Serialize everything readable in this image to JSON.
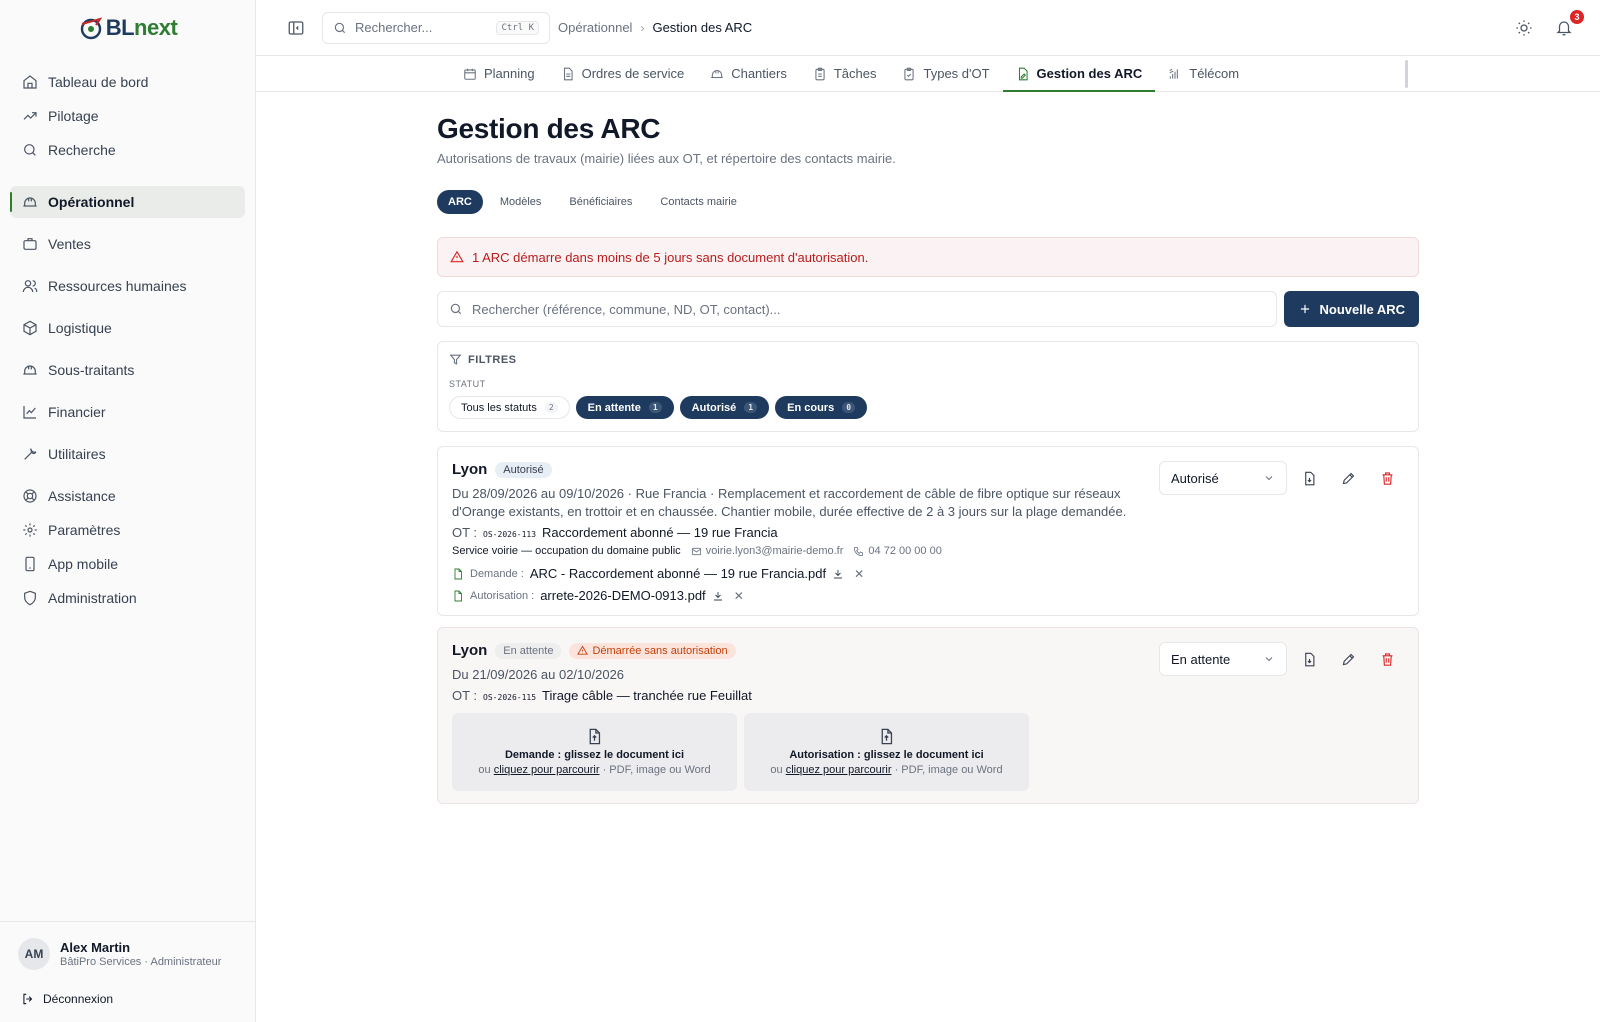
{
  "app": {
    "logo_prefix": "BL",
    "logo_suffix": "next"
  },
  "sidebar": {
    "items": [
      {
        "label": "Tableau de bord",
        "icon": "home-icon"
      },
      {
        "label": "Pilotage",
        "icon": "trending-up-icon"
      },
      {
        "label": "Recherche",
        "icon": "search-icon"
      },
      {
        "label": "Opérationnel",
        "icon": "hard-hat-icon",
        "active": true
      },
      {
        "label": "Ventes",
        "icon": "briefcase-icon"
      },
      {
        "label": "Ressources humaines",
        "icon": "users-icon"
      },
      {
        "label": "Logistique",
        "icon": "package-icon"
      },
      {
        "label": "Sous-traitants",
        "icon": "hard-hat-icon"
      },
      {
        "label": "Financier",
        "icon": "line-chart-icon"
      },
      {
        "label": "Utilitaires",
        "icon": "wrench-icon"
      },
      {
        "label": "Assistance",
        "icon": "lifebuoy-icon"
      },
      {
        "label": "Paramètres",
        "icon": "gear-icon"
      },
      {
        "label": "App mobile",
        "icon": "smartphone-icon"
      },
      {
        "label": "Administration",
        "icon": "shield-icon"
      }
    ],
    "user": {
      "initials": "AM",
      "name": "Alex Martin",
      "role": "BâtiPro Services · Administrateur"
    },
    "logout_label": "Déconnexion"
  },
  "topbar": {
    "search_placeholder": "Rechercher...",
    "search_shortcut": "Ctrl K",
    "breadcrumb_parent": "Opérationnel",
    "breadcrumb_current": "Gestion des ARC",
    "notification_count": "3"
  },
  "tabs": [
    {
      "label": "Planning",
      "icon": "calendar-icon"
    },
    {
      "label": "Ordres de service",
      "icon": "file-text-icon"
    },
    {
      "label": "Chantiers",
      "icon": "hard-hat-icon"
    },
    {
      "label": "Tâches",
      "icon": "clipboard-icon"
    },
    {
      "label": "Types d'OT",
      "icon": "clipboard-check-icon"
    },
    {
      "label": "Gestion des ARC",
      "icon": "file-edit-icon",
      "active": true
    },
    {
      "label": "Télécom",
      "icon": "signal-icon"
    }
  ],
  "page": {
    "title": "Gestion des ARC",
    "subtitle": "Autorisations de travaux (mairie) liées aux OT, et répertoire des contacts mairie.",
    "subtabs": [
      "ARC",
      "Modèles",
      "Bénéficiaires",
      "Contacts mairie"
    ],
    "alert": "1 ARC démarre dans moins de 5 jours sans document d'autorisation.",
    "search_placeholder": "Rechercher (référence, commune, ND, OT, contact)...",
    "new_button": "Nouvelle ARC"
  },
  "filters": {
    "heading": "FILTRES",
    "statut_label": "STATUT",
    "chips": [
      {
        "label": "Tous les statuts",
        "count": "2",
        "active": false
      },
      {
        "label": "En attente",
        "count": "1",
        "active": true
      },
      {
        "label": "Autorisé",
        "count": "1",
        "active": true
      },
      {
        "label": "En cours",
        "count": "0",
        "active": true
      }
    ]
  },
  "cards": [
    {
      "city": "Lyon",
      "status": "Autorisé",
      "description": "Du 28/09/2026 au 09/10/2026 · Rue Francia · Remplacement et raccordement de câble de fibre optique sur réseaux d'Orange existants, en trottoir et en chaussée. Chantier mobile, durée effective de 2 à 3 jours sur la plage demandée.",
      "ot_label": "OT :",
      "ot_code": "OS-2026-113",
      "ot_title": "Raccordement abonné — 19 rue Francia",
      "contact_service": "Service voirie — occupation du domaine public",
      "contact_email": "voirie.lyon3@mairie-demo.fr",
      "contact_phone": "04 72 00 00 00",
      "demande_label": "Demande :",
      "demande_file": "ARC - Raccordement abonné — 19 rue Francia.pdf",
      "autorisation_label": "Autorisation :",
      "autorisation_file": "arrete-2026-DEMO-0913.pdf",
      "select_value": "Autorisé"
    },
    {
      "city": "Lyon",
      "status": "En attente",
      "warning": "Démarrée sans autorisation",
      "description": "Du 21/09/2026 au 02/10/2026",
      "ot_label": "OT :",
      "ot_code": "OS-2026-115",
      "ot_title": "Tirage câble — tranchée rue Feuillat",
      "select_value": "En attente",
      "dropzones": [
        {
          "title": "Demande : glissez le document ici",
          "prefix": "ou",
          "link": "cliquez pour parcourir",
          "suffix": "· PDF, image ou Word"
        },
        {
          "title": "Autorisation : glissez le document ici",
          "prefix": "ou",
          "link": "cliquez pour parcourir",
          "suffix": "· PDF, image ou Word"
        }
      ]
    }
  ]
}
